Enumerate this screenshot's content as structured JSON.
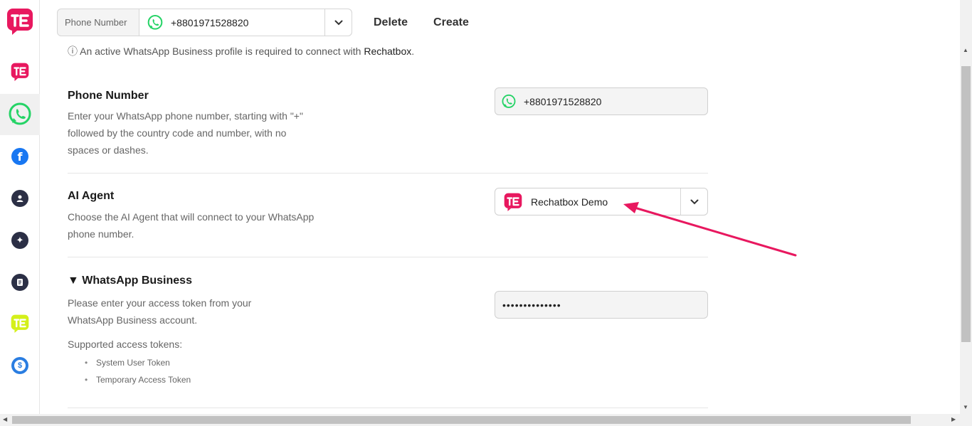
{
  "topbar": {
    "phone_label": "Phone Number",
    "phone_value": "+8801971528820",
    "delete_label": "Delete",
    "create_label": "Create"
  },
  "notice": {
    "icon": "ⓘ",
    "text": " An active WhatsApp Business profile is required to connect with ",
    "brand": "Rechatbox",
    "end": "."
  },
  "phone_section": {
    "title": "Phone Number",
    "desc_line1": "Enter your WhatsApp phone number, starting with \"+\"",
    "desc_line2": "followed by the country code and number, with no",
    "desc_line3": "spaces or dashes.",
    "value": "+8801971528820"
  },
  "agent_section": {
    "title": "AI Agent",
    "desc_line1": "Choose the AI Agent that will connect to your WhatsApp",
    "desc_line2": "phone number.",
    "value": "Rechatbox Demo"
  },
  "business_section": {
    "title": "▼ WhatsApp Business",
    "desc_line1": "Please enter your access token from your",
    "desc_line2": "WhatsApp Business account.",
    "token_value": "••••••••••••••",
    "supported_label": "Supported access tokens:",
    "tokens": [
      "System User Token",
      "Temporary Access Token"
    ]
  },
  "icons": {
    "brand_logo": "rechatbox-logo",
    "whatsapp": "whatsapp-icon",
    "facebook": "facebook-icon",
    "user": "user-icon",
    "sparkle": "sparkle-icon",
    "document": "document-icon",
    "dollar": "dollar-icon"
  },
  "colors": {
    "brand": "#e8185f",
    "whatsapp": "#25d366",
    "facebook": "#1877f2",
    "dark_icon": "#2b2f45",
    "lime": "#d4f01a",
    "dollar": "#2a7de1",
    "annotation": "#e8185f"
  }
}
